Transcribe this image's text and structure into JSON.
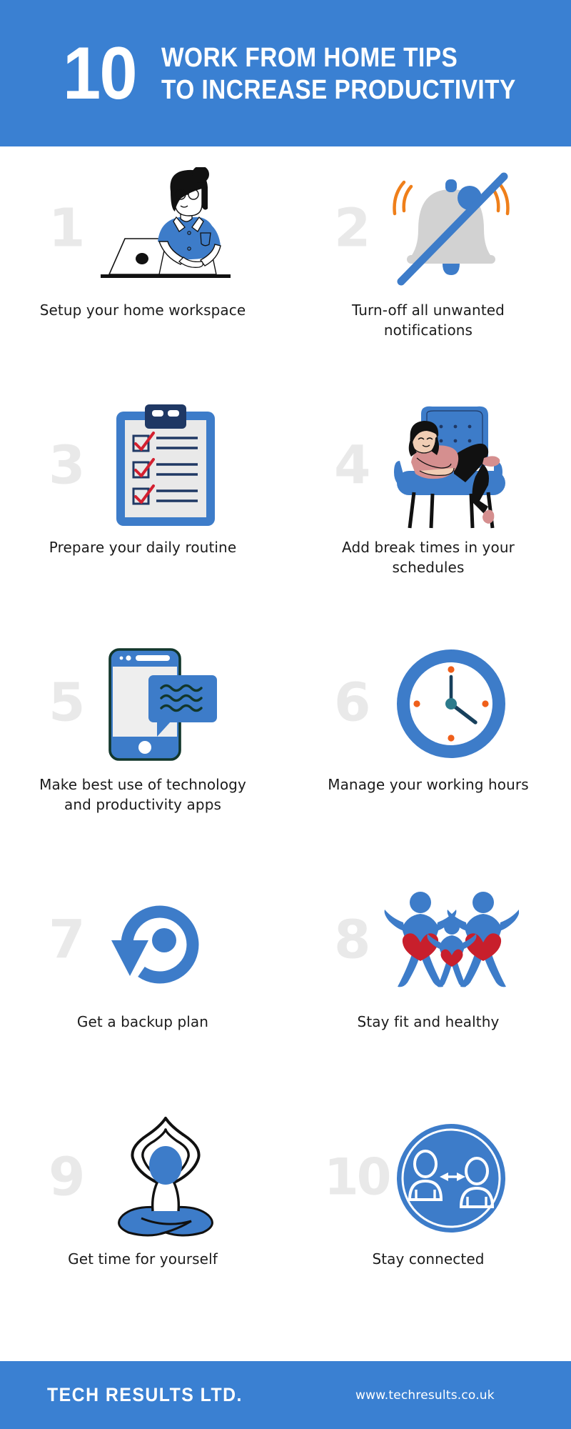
{
  "header": {
    "big_number": "10",
    "title_line1": "WORK FROM HOME TIPS",
    "title_line2": "TO INCREASE PRODUCTIVITY",
    "background_color": "#3a80d2",
    "text_color": "#ffffff"
  },
  "theme": {
    "brand_blue": "#3a80d2",
    "icon_blue": "#3d7cc9",
    "number_grey": "#e9e9e9",
    "navy": "#1f3864",
    "red": "#d32030",
    "orange": "#ef7f1a",
    "skin": "#f0cdb4",
    "pink": "#d58f8f",
    "black": "#111111",
    "page_background": "#ffffff"
  },
  "tips": [
    {
      "number": "1",
      "label": "Setup your home workspace",
      "icon": "woman-at-laptop-icon"
    },
    {
      "number": "2",
      "label": "Turn-off all unwanted notifications",
      "icon": "bell-muted-icon"
    },
    {
      "number": "3",
      "label": "Prepare your daily routine",
      "icon": "clipboard-checklist-icon"
    },
    {
      "number": "4",
      "label": "Add break times in your schedules",
      "icon": "woman-relaxing-in-armchair-icon"
    },
    {
      "number": "5",
      "label": "Make best use of technology and productivity apps",
      "icon": "smartphone-chat-bubble-icon"
    },
    {
      "number": "6",
      "label": "Manage your working hours",
      "icon": "wall-clock-icon"
    },
    {
      "number": "7",
      "label": "Get a backup plan",
      "icon": "restore-backup-arrow-icon"
    },
    {
      "number": "8",
      "label": "Stay fit and healthy",
      "icon": "family-hearts-icon"
    },
    {
      "number": "9",
      "label": "Get time for yourself",
      "icon": "yoga-meditation-icon"
    },
    {
      "number": "10",
      "label": "Stay connected",
      "icon": "two-people-connected-icon"
    }
  ],
  "footer": {
    "brand": "TECH RESULTS LTD.",
    "url": "www.techresults.co.uk",
    "background_color": "#3a80d2"
  }
}
